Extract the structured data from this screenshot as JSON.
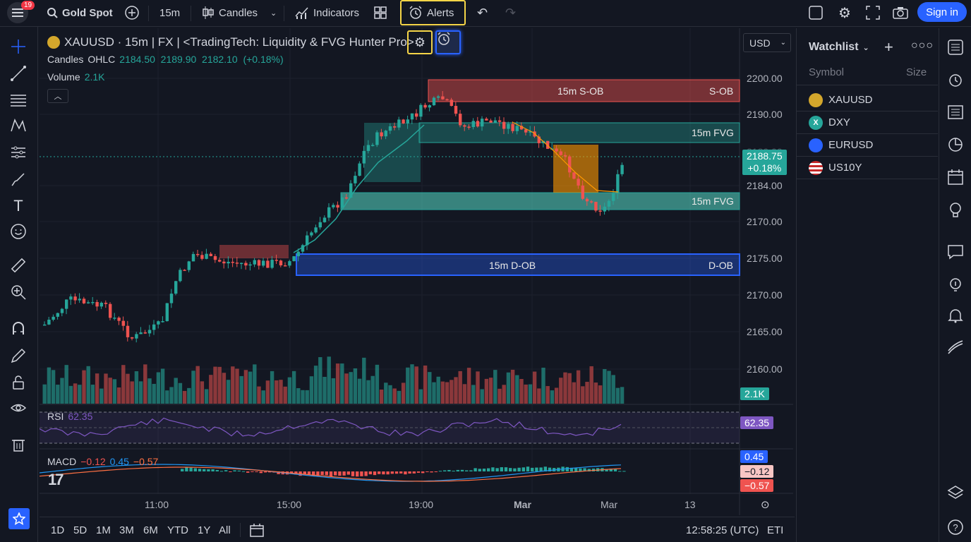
{
  "topbar": {
    "notif_count": "19",
    "symbol": "Gold Spot",
    "interval": "15m",
    "chart_type": "Candles",
    "indicators": "Indicators",
    "alerts": "Alerts",
    "sign_in": "Sign in"
  },
  "legend": {
    "title": "XAUUSD · 15m | FX | <TradingTech: Liquidity & FVG Hunter Pro>",
    "candles_label": "Candles",
    "ohlc_label": "OHLC",
    "ohlc_values": "2184.50  2189.90  2182.10  (+0.18%)",
    "volume_label": "Volume",
    "volume_value": "2.1K"
  },
  "currency": "USD",
  "zones": {
    "s_ob_center": "15m S-OB",
    "s_ob_right": "S-OB",
    "fvg_top": "15m FVG",
    "fvg_mid": "15m FVG",
    "d_ob_center": "15m D-OB",
    "d_ob_right": "D-OB"
  },
  "price_axis": [
    "2200.00",
    "2190.00",
    "2184.00",
    "2170.00",
    "2175.00",
    "2170.00",
    "2165.00",
    "2160.00"
  ],
  "price_axis_faded": "2180.00",
  "current_price": {
    "price": "2188.75",
    "change": "+0.18%"
  },
  "volume_tag": "2.1K",
  "rsi": {
    "label": "RSI",
    "value": "62.35",
    "tag": "62.35"
  },
  "macd": {
    "label": "MACD",
    "v1": "−0.12",
    "v2": "0.45",
    "v3": "−0.57",
    "tag_signal": "0.45",
    "tag_macd": "−0.12",
    "tag_hist": "−0.57"
  },
  "time_axis": [
    "11:00",
    "15:00",
    "19:00",
    "Mar",
    "Mar",
    "13"
  ],
  "bottombar": {
    "ranges": [
      "1D",
      "5D",
      "1M",
      "3M",
      "6M",
      "YTD",
      "1Y",
      "All"
    ],
    "clock": "12:58:25 (UTC)",
    "session": "ETI"
  },
  "watchlist": {
    "title": "Watchlist",
    "col_symbol": "Symbol",
    "col_size": "Size",
    "items": [
      {
        "symbol": "XAUUSD",
        "icon": "gold-coin-icon",
        "color": "#d4a72c"
      },
      {
        "symbol": "DXY",
        "icon": "dxy-icon",
        "color": "#26a69a"
      },
      {
        "symbol": "EURUSD",
        "icon": "eu-flag-icon",
        "color": "#2962ff"
      },
      {
        "symbol": "US10Y",
        "icon": "us-flag-icon",
        "color": "#c62828"
      }
    ]
  },
  "colors": {
    "bull": "#26a69a",
    "bear": "#ef5350",
    "accent": "#2962ff",
    "highlight": "#f5d547"
  }
}
